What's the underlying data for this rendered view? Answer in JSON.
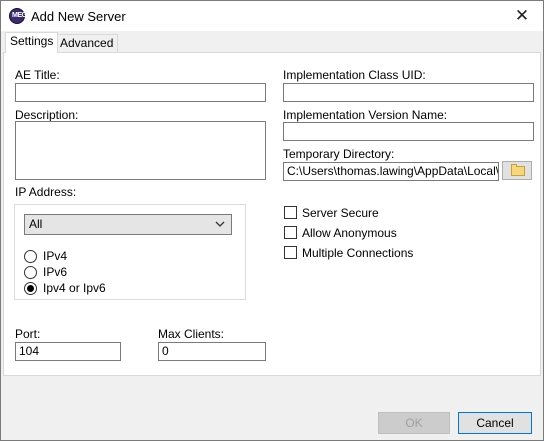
{
  "window": {
    "title": "Add New Server",
    "icon_text": "MEG"
  },
  "tabs": [
    {
      "label": "Settings"
    },
    {
      "label": "Advanced"
    }
  ],
  "left": {
    "ae_title_label": "AE Title:",
    "ae_title_value": "",
    "description_label": "Description:",
    "description_value": "",
    "ip_address_label": "IP Address:",
    "ip_select_value": "All",
    "radios": [
      {
        "label": "IPv4",
        "checked": false
      },
      {
        "label": "IPv6",
        "checked": false
      },
      {
        "label": "Ipv4 or Ipv6",
        "checked": true
      }
    ],
    "port_label": "Port:",
    "port_value": "104",
    "max_clients_label": "Max Clients:",
    "max_clients_value": "0"
  },
  "right": {
    "impl_class_uid_label": "Implementation Class UID:",
    "impl_class_uid_value": "",
    "impl_version_label": "Implementation Version Name:",
    "impl_version_value": "",
    "temp_dir_label": "Temporary Directory:",
    "temp_dir_value": "C:\\Users\\thomas.lawing\\AppData\\Local\\Temp\\",
    "checkboxes": [
      {
        "label": "Server Secure",
        "checked": false
      },
      {
        "label": "Allow Anonymous",
        "checked": false
      },
      {
        "label": "Multiple Connections",
        "checked": false
      }
    ]
  },
  "footer": {
    "ok_label": "OK",
    "cancel_label": "Cancel"
  }
}
